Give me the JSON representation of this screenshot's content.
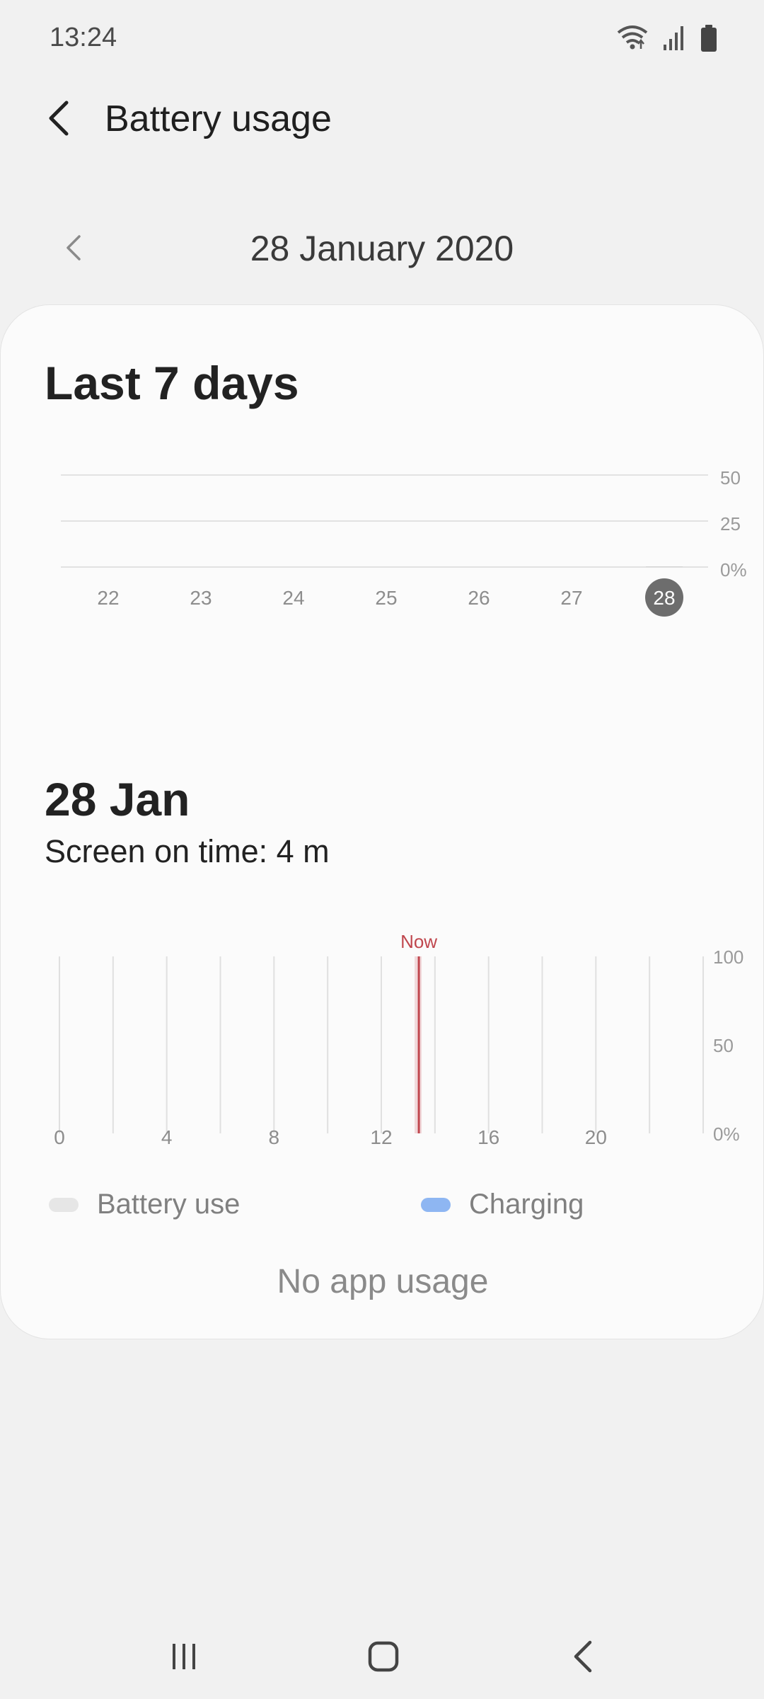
{
  "status_bar": {
    "time": "13:24",
    "icons": [
      "wifi-icon",
      "signal-icon",
      "battery-icon"
    ]
  },
  "header": {
    "title": "Battery usage",
    "back_icon": "back-arrow-icon"
  },
  "date_selector": {
    "date": "28 January 2020",
    "prev_icon": "chevron-left-icon"
  },
  "week": {
    "title": "Last 7 days"
  },
  "day": {
    "title": "28 Jan",
    "screen_on_time": "Screen on time: 4 m"
  },
  "legend": {
    "battery_use": "Battery use",
    "charging": "Charging",
    "battery_use_color": "#e6e6e6",
    "charging_color": "#8eb6f2"
  },
  "no_usage": "No app usage",
  "colors": {
    "now_marker": "#c0474e",
    "selected_day": "#6d6d6d"
  },
  "chart_data": [
    {
      "type": "bar",
      "categories": [
        "22",
        "23",
        "24",
        "25",
        "26",
        "27",
        "28"
      ],
      "values": [
        0,
        0,
        0,
        0,
        0,
        0,
        0.3
      ],
      "selected": "28",
      "yticks": [
        "0%",
        "25",
        "50"
      ],
      "ylim": [
        0,
        50
      ],
      "grid": true,
      "axis_position": "right"
    },
    {
      "type": "area",
      "xticks": [
        "0",
        "4",
        "8",
        "12",
        "16",
        "20"
      ],
      "xlim": [
        0,
        24
      ],
      "yticks": [
        "0%",
        "50",
        "100"
      ],
      "ylim": [
        0,
        100
      ],
      "now_label": "Now",
      "now_hour": 13.4,
      "grid": true,
      "axis_position": "right"
    }
  ],
  "nav_bar": {
    "recents_icon": "recents-icon",
    "home_icon": "home-icon",
    "back_icon": "back-icon"
  }
}
